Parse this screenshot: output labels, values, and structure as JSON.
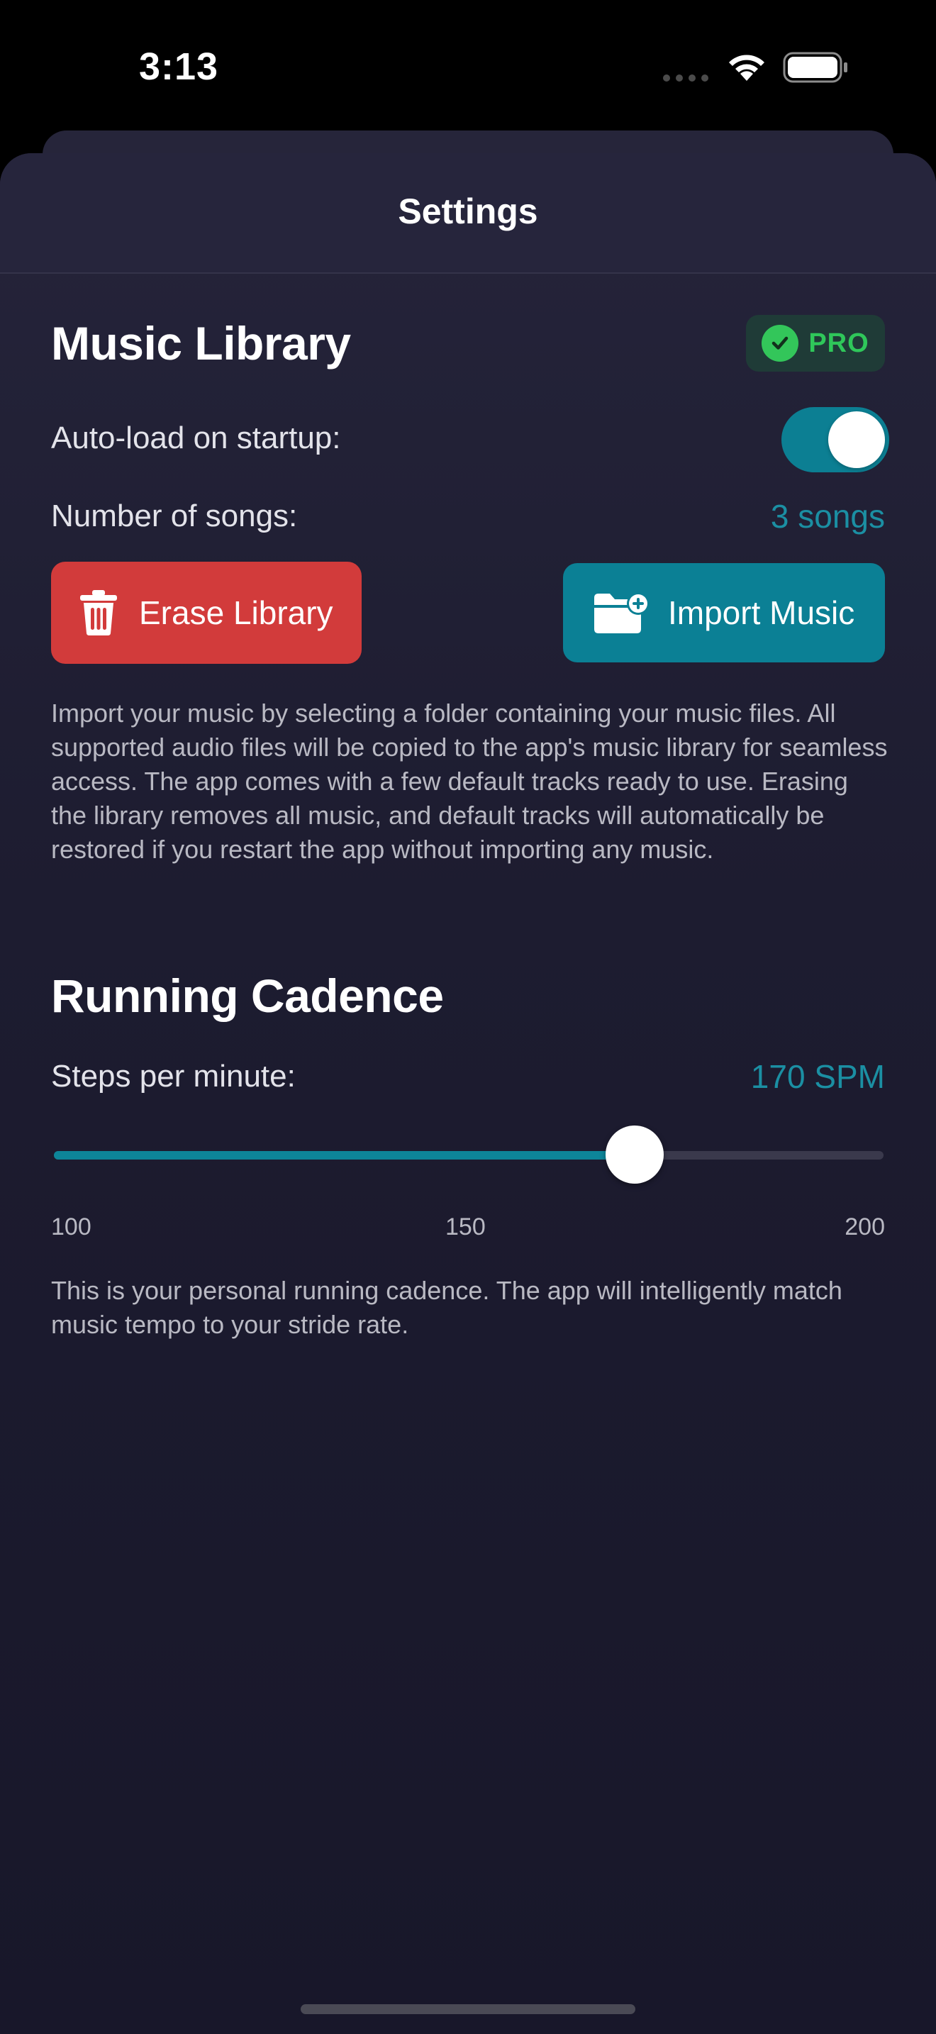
{
  "status_bar": {
    "time": "3:13"
  },
  "sheet": {
    "title": "Settings"
  },
  "music_library": {
    "title": "Music Library",
    "badge": "PRO",
    "autoload_label": "Auto-load on startup:",
    "autoload_enabled": true,
    "songs_label": "Number of songs:",
    "songs_value": "3 songs",
    "erase_label": "Erase Library",
    "import_label": "Import Music",
    "description": "Import your music by selecting a folder containing your music files. All supported audio files will be copied to the app's music library for seamless access. The app comes with a few default tracks ready to use. Erasing the library removes all music, and default tracks will automatically be restored if you restart the app without importing any music."
  },
  "running_cadence": {
    "title": "Running Cadence",
    "spm_label": "Steps per minute:",
    "spm_value": "170 SPM",
    "slider": {
      "min": 100,
      "max": 200,
      "value": 170
    },
    "ticks": {
      "min": "100",
      "mid": "150",
      "max": "200"
    },
    "description": "This is your personal running cadence. The app will intelligently match music tempo to your stride rate."
  },
  "colors": {
    "accent_teal": "#0b8095",
    "value_teal": "#1b8fa3",
    "erase_red": "#d23b3b",
    "pro_green": "#2fc75a"
  },
  "icons": {
    "erase": "trash-icon",
    "import": "folder-plus-icon",
    "badge": "checkmark-icon"
  }
}
